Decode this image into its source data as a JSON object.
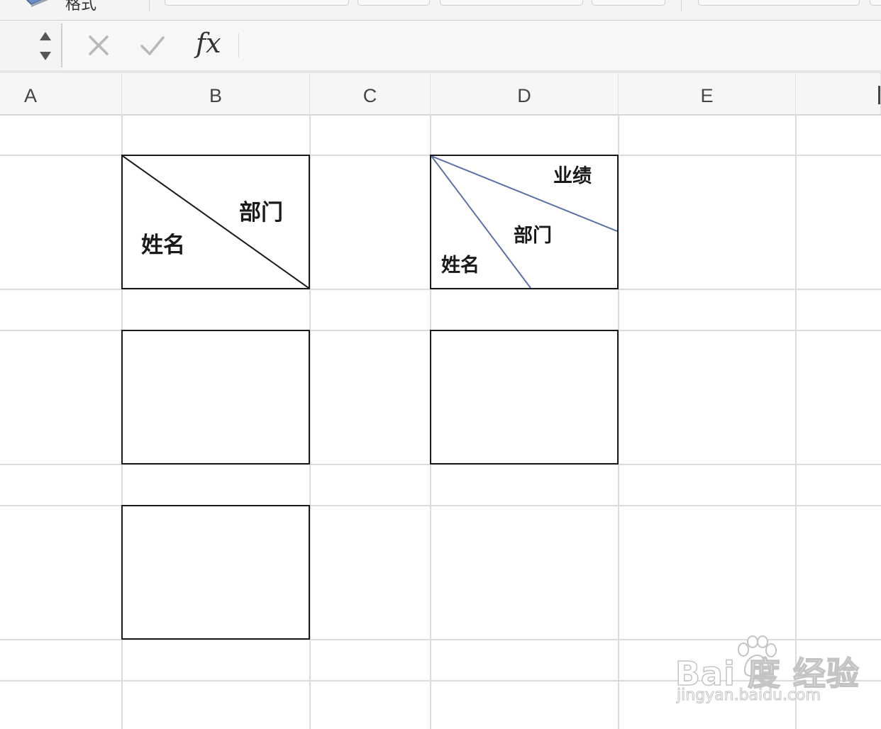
{
  "ribbon": {
    "format_label": "格式",
    "format_icon": "paint-format-icon"
  },
  "formula_bar": {
    "cancel_icon": "close-icon",
    "confirm_icon": "check-icon",
    "fx_label": "fx",
    "formula_value": ""
  },
  "columns": [
    "A",
    "B",
    "C",
    "D",
    "E",
    "F"
  ],
  "cells": {
    "b_header": {
      "bottom_left": "姓名",
      "top_right": "部门"
    },
    "d_header": {
      "bottom_left": "姓名",
      "middle": "部门",
      "top_right": "业绩"
    }
  },
  "watermark": {
    "logo": "Bai 度 经验",
    "url": "jingyan.baidu.com"
  },
  "colors": {
    "cell_border": "#1a1a1a",
    "diagonal_line_b": "#1a1a1a",
    "diagonal_line_d": "#5b6fa8",
    "gridline": "#dcdcdc"
  }
}
